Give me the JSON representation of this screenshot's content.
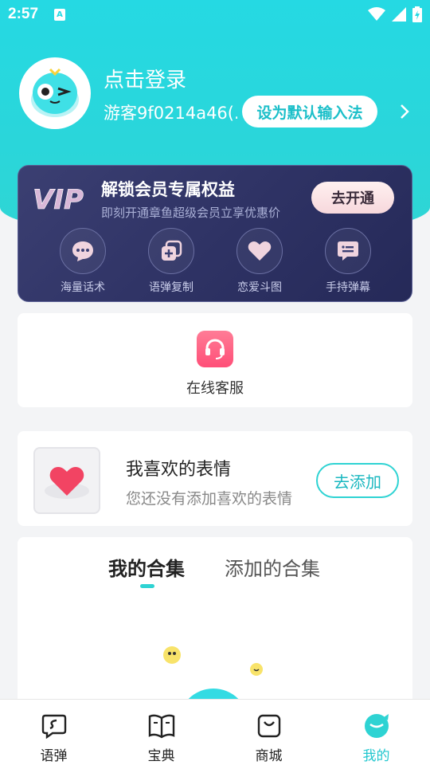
{
  "status_bar": {
    "time": "2:57",
    "notification_badge": "A"
  },
  "profile": {
    "login_title": "点击登录",
    "guest_id": "游客9f0214a46(...",
    "set_default_button": "设为默认输入法"
  },
  "vip": {
    "logo_text": "VIP",
    "title": "解锁会员专属权益",
    "subtitle": "即刻开通章鱼超级会员立享优惠价",
    "cta_button": "去开通",
    "features": [
      {
        "label": "海量话术",
        "icon": "chat-bubble-icon"
      },
      {
        "label": "语弹复制",
        "icon": "copy-plus-icon"
      },
      {
        "label": "恋爱斗图",
        "icon": "heart-icon"
      },
      {
        "label": "手持弹幕",
        "icon": "danmaku-icon"
      }
    ]
  },
  "service": {
    "label": "在线客服",
    "icon": "headset-icon"
  },
  "favorites": {
    "title": "我喜欢的表情",
    "subtitle": "您还没有添加喜欢的表情",
    "add_button": "去添加"
  },
  "collections": {
    "tabs": [
      {
        "label": "我的合集",
        "active": true
      },
      {
        "label": "添加的合集",
        "active": false
      }
    ]
  },
  "bottom_nav": {
    "items": [
      {
        "label": "语弹",
        "icon": "yudan-icon",
        "active": false
      },
      {
        "label": "宝典",
        "icon": "book-icon",
        "active": false
      },
      {
        "label": "商城",
        "icon": "shop-bag-icon",
        "active": false
      },
      {
        "label": "我的",
        "icon": "profile-icon",
        "active": true
      }
    ]
  },
  "colors": {
    "accent": "#2ed3d3",
    "header_bg": "#25d9e3",
    "vip_bg": "#2f3365",
    "service_icon": "#ff5a80"
  }
}
